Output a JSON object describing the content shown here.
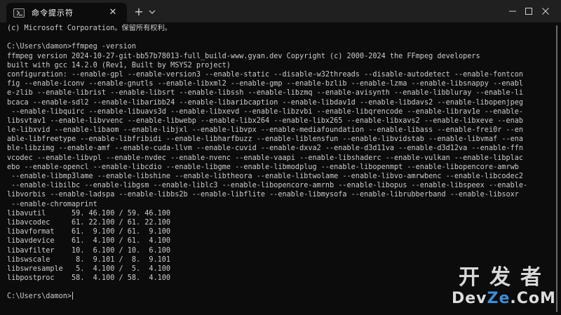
{
  "window": {
    "tab_title": "命令提示符",
    "tab_close_glyph": "✕",
    "new_tab_glyph": "+",
    "icons": {
      "tab": "terminal-icon",
      "tab_close": "close-icon",
      "new_tab": "plus-icon",
      "dropdown": "chevron-down-icon",
      "minimize": "minimize-icon",
      "maximize": "maximize-icon",
      "close": "close-icon"
    }
  },
  "terminal": {
    "lines": [
      "(c) Microsoft Corporation。保留所有权利。",
      "",
      "C:\\Users\\damon>ffmpeg -version",
      "ffmpeg version 2024-10-27-git-bb57b78013-full_build-www.gyan.dev Copyright (c) 2000-2024 the FFmpeg developers",
      "built with gcc 14.2.0 (Rev1, Built by MSYS2 project)",
      "configuration: --enable-gpl --enable-version3 --enable-static --disable-w32threads --disable-autodetect --enable-fontcon",
      "fig --enable-iconv --enable-gnutls --enable-libxml2 --enable-gmp --enable-bzlib --enable-lzma --enable-libsnappy --enabl",
      "e-zlib --enable-librist --enable-libsrt --enable-libssh --enable-libzmq --enable-avisynth --enable-libbluray --enable-li",
      "bcaca --enable-sdl2 --enable-libaribb24 --enable-libaribcaption --enable-libdav1d --enable-libdavs2 --enable-libopenjpeg",
      " --enable-libquirc --enable-libuavs3d --enable-libxevd --enable-libzvbi --enable-libqrencode --enable-librav1e --enable-",
      "libsvtav1 --enable-libvvenc --enable-libwebp --enable-libx264 --enable-libx265 --enable-libxavs2 --enable-libxeve --enab",
      "le-libxvid --enable-libaom --enable-libjxl --enable-libvpx --enable-mediafoundation --enable-libass --enable-frei0r --en",
      "able-libfreetype --enable-libfribidi --enable-libharfbuzz --enable-liblensfun --enable-libvidstab --enable-libvmaf --ena",
      "ble-libzimg --enable-amf --enable-cuda-llvm --enable-cuvid --enable-dxva2 --enable-d3d11va --enable-d3d12va --enable-ffn",
      "vcodec --enable-libvpl --enable-nvdec --enable-nvenc --enable-vaapi --enable-libshaderc --enable-vulkan --enable-libplac",
      "ebo --enable-opencl --enable-libcdio --enable-libgme --enable-libmodplug --enable-libopenmpt --enable-libopencore-amrwb",
      " --enable-libmp3lame --enable-libshine --enable-libtheora --enable-libtwolame --enable-libvo-amrwbenc --enable-libcodec2",
      " --enable-libilbc --enable-libgsm --enable-liblc3 --enable-libopencore-amrnb --enable-libopus --enable-libspeex --enable-",
      "libvorbis --enable-ladspa --enable-libbs2b --enable-libflite --enable-libmysofa --enable-librubberband --enable-libsoxr",
      " --enable-chromaprint",
      "libavutil      59. 46.100 / 59. 46.100",
      "libavcodec     61. 22.100 / 61. 22.100",
      "libavformat    61.  9.100 / 61.  9.100",
      "libavdevice    61.  4.100 / 61.  4.100",
      "libavfilter    10.  6.100 / 10.  6.100",
      "libswscale      8.  9.101 /  8.  9.101",
      "libswresample   5.  4.100 /  5.  4.100",
      "libpostproc    58.  4.100 / 58.  4.100",
      "",
      "C:\\Users\\damon>"
    ]
  },
  "watermark": {
    "top": "开发者",
    "dev": "Dev",
    "ze": "Ze",
    "com": ".CoM",
    "colors": {
      "ze": "#3c8ed6",
      "text": "#dcdcdc"
    }
  }
}
